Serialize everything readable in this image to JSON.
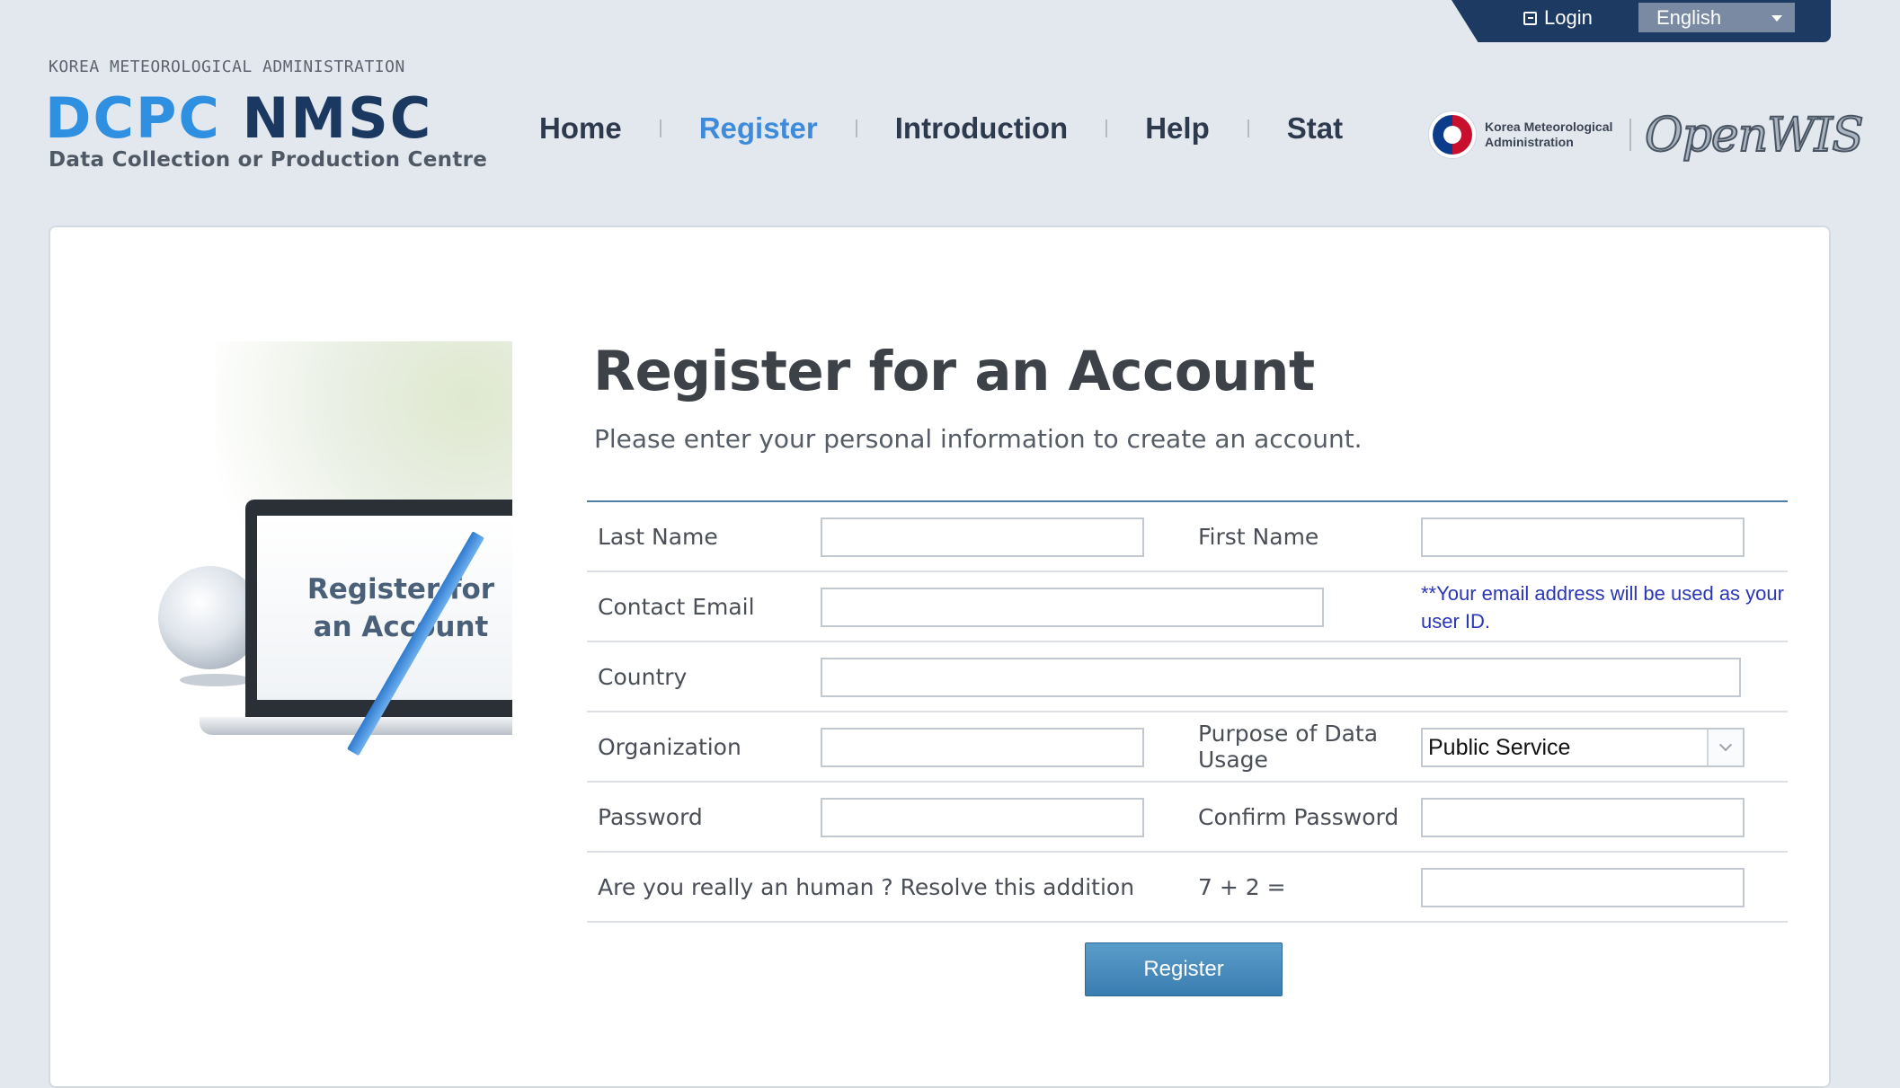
{
  "topbar": {
    "login_label": "Login",
    "language": "English"
  },
  "header": {
    "agency": "KOREA METEOROLOGICAL ADMINISTRATION",
    "brand_part1": "DCPC",
    "brand_part2": "NMSC",
    "brand_subtitle": "Data Collection or Production Centre",
    "kma_logo_text": "Korea Meteorological Administration",
    "openwis_logo": "OpenWIS"
  },
  "nav": {
    "items": [
      "Home",
      "Register",
      "Introduction",
      "Help",
      "Stat"
    ],
    "active": "Register"
  },
  "illustration": {
    "screen_text_line1": "Register for",
    "screen_text_line2": "an Account"
  },
  "form": {
    "title": "Register for an Account",
    "subtitle": "Please enter your personal information to create an account.",
    "fields": {
      "last_name": {
        "label": "Last Name",
        "value": ""
      },
      "first_name": {
        "label": "First Name",
        "value": ""
      },
      "email": {
        "label": "Contact Email",
        "value": "",
        "note": "**Your email address will be used as your user ID."
      },
      "country": {
        "label": "Country",
        "value": ""
      },
      "organization": {
        "label": "Organization",
        "value": ""
      },
      "purpose": {
        "label_line1": "Purpose of Data",
        "label_line2": "Usage",
        "value": "Public Service"
      },
      "password": {
        "label": "Password",
        "value": ""
      },
      "confirm_password": {
        "label": "Confirm Password",
        "value": ""
      },
      "captcha": {
        "label": "Are you really an human ? Resolve this addition",
        "question": "7 + 2 =",
        "value": ""
      }
    },
    "submit_label": "Register"
  },
  "colors": {
    "topbar_bg": "#1d3a63",
    "brand_blue": "#2f8fe0",
    "brand_navy": "#1b3860",
    "nav_active": "#3e8bdc",
    "note_text": "#2a36b5",
    "button_bg": "#3a7db0"
  }
}
